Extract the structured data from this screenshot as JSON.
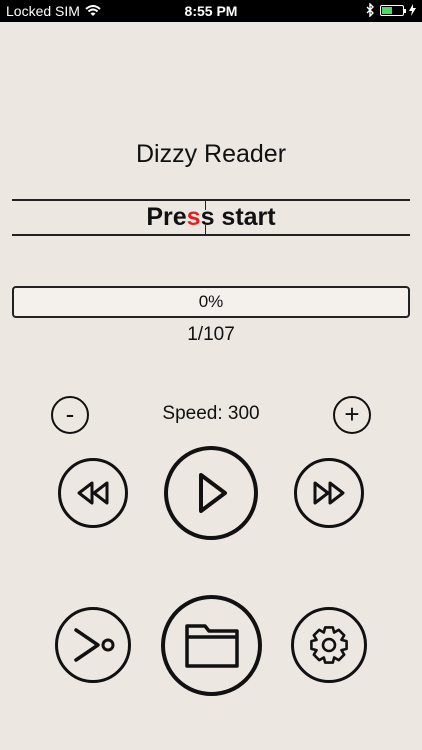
{
  "status_bar": {
    "carrier": "Locked SIM",
    "time": "8:55 PM",
    "battery_level": 0.5,
    "battery_color": "#4cd964"
  },
  "reader": {
    "title": "Dizzy Reader",
    "word_prefix": "Pre",
    "word_focus": "s",
    "word_suffix": "s start",
    "focus_color": "#e02020"
  },
  "progress": {
    "label": "0%",
    "value": 0,
    "page": "1/107"
  },
  "speed": {
    "label": "Speed: 300",
    "decrease_symbol": "-",
    "increase_symbol": "+"
  },
  "controls": {
    "icons": [
      "rewind-icon",
      "play-icon",
      "fast-forward-icon",
      "jump-icon",
      "folder-icon",
      "gear-icon"
    ]
  }
}
